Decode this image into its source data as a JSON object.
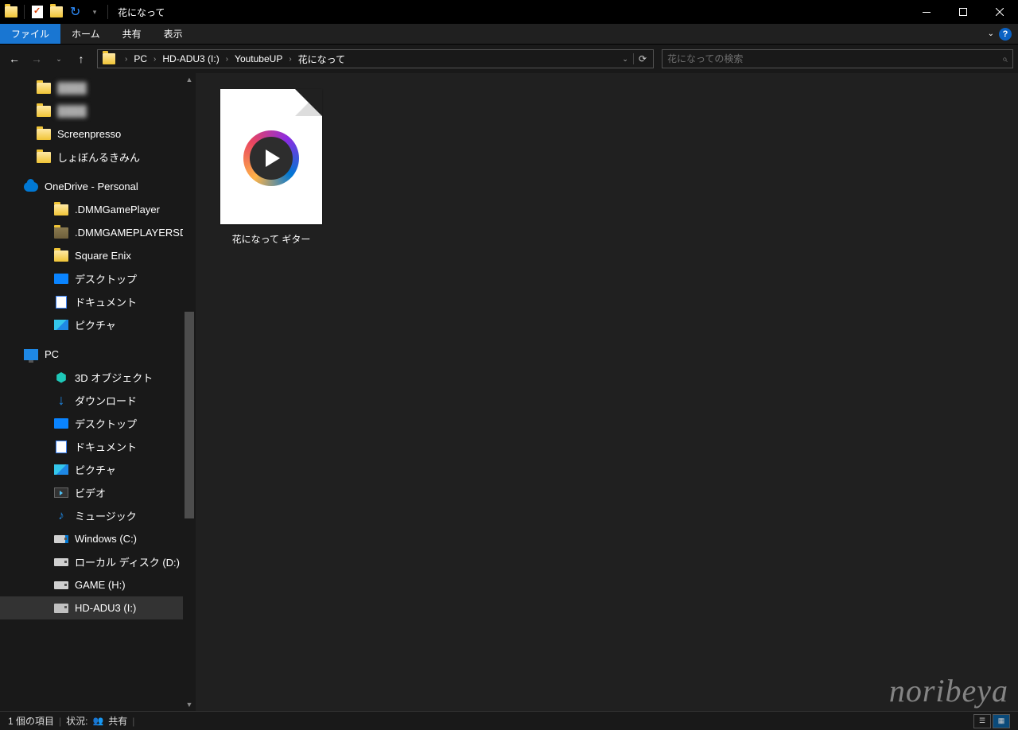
{
  "window": {
    "title": "花になって"
  },
  "ribbon": {
    "file": "ファイル",
    "tabs": [
      "ホーム",
      "共有",
      "表示"
    ]
  },
  "breadcrumb": {
    "items": [
      "PC",
      "HD-ADU3 (I:)",
      "YoutubeUP",
      "花になって"
    ]
  },
  "search": {
    "placeholder": "花になっての検索"
  },
  "sidebar": {
    "hidden1": "████",
    "hidden2": "████",
    "items_top": [
      {
        "label": "Screenpresso",
        "icon": "folder"
      },
      {
        "label": "しょぼんるきみん",
        "icon": "folder"
      }
    ],
    "onedrive": {
      "label": "OneDrive - Personal",
      "children": [
        {
          "label": ".DMMGamePlayer",
          "icon": "folder"
        },
        {
          "label": ".DMMGAMEPLAYERSD",
          "icon": "folder-dark"
        },
        {
          "label": "Square Enix",
          "icon": "folder"
        },
        {
          "label": "デスクトップ",
          "icon": "desktop"
        },
        {
          "label": "ドキュメント",
          "icon": "doc"
        },
        {
          "label": "ピクチャ",
          "icon": "pic"
        }
      ]
    },
    "pc": {
      "label": "PC",
      "children": [
        {
          "label": "3D オブジェクト",
          "icon": "3d"
        },
        {
          "label": "ダウンロード",
          "icon": "down"
        },
        {
          "label": "デスクトップ",
          "icon": "desktop"
        },
        {
          "label": "ドキュメント",
          "icon": "doc"
        },
        {
          "label": "ピクチャ",
          "icon": "pic"
        },
        {
          "label": "ビデオ",
          "icon": "video"
        },
        {
          "label": "ミュージック",
          "icon": "music"
        },
        {
          "label": "Windows (C:)",
          "icon": "drive-sys"
        },
        {
          "label": "ローカル ディスク (D:)",
          "icon": "drive"
        },
        {
          "label": "GAME (H:)",
          "icon": "drive"
        },
        {
          "label": "HD-ADU3 (I:)",
          "icon": "drive-ext"
        }
      ]
    }
  },
  "files": {
    "item0": {
      "label": "花になって ギター"
    }
  },
  "status": {
    "count": "1 個の項目",
    "share_label": "状況:",
    "share_value": "共有"
  },
  "watermark": "noribeya"
}
